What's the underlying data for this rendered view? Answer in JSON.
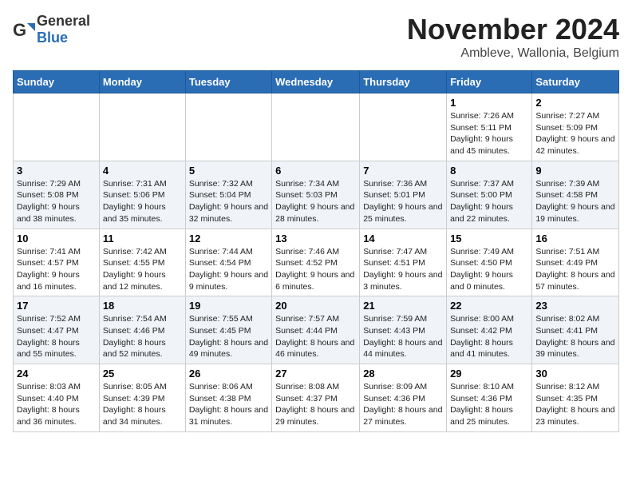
{
  "header": {
    "logo_general": "General",
    "logo_blue": "Blue",
    "month_title": "November 2024",
    "location": "Ambleve, Wallonia, Belgium"
  },
  "weekdays": [
    "Sunday",
    "Monday",
    "Tuesday",
    "Wednesday",
    "Thursday",
    "Friday",
    "Saturday"
  ],
  "weeks": [
    [
      {
        "day": "",
        "info": ""
      },
      {
        "day": "",
        "info": ""
      },
      {
        "day": "",
        "info": ""
      },
      {
        "day": "",
        "info": ""
      },
      {
        "day": "",
        "info": ""
      },
      {
        "day": "1",
        "info": "Sunrise: 7:26 AM\nSunset: 5:11 PM\nDaylight: 9 hours and 45 minutes."
      },
      {
        "day": "2",
        "info": "Sunrise: 7:27 AM\nSunset: 5:09 PM\nDaylight: 9 hours and 42 minutes."
      }
    ],
    [
      {
        "day": "3",
        "info": "Sunrise: 7:29 AM\nSunset: 5:08 PM\nDaylight: 9 hours and 38 minutes."
      },
      {
        "day": "4",
        "info": "Sunrise: 7:31 AM\nSunset: 5:06 PM\nDaylight: 9 hours and 35 minutes."
      },
      {
        "day": "5",
        "info": "Sunrise: 7:32 AM\nSunset: 5:04 PM\nDaylight: 9 hours and 32 minutes."
      },
      {
        "day": "6",
        "info": "Sunrise: 7:34 AM\nSunset: 5:03 PM\nDaylight: 9 hours and 28 minutes."
      },
      {
        "day": "7",
        "info": "Sunrise: 7:36 AM\nSunset: 5:01 PM\nDaylight: 9 hours and 25 minutes."
      },
      {
        "day": "8",
        "info": "Sunrise: 7:37 AM\nSunset: 5:00 PM\nDaylight: 9 hours and 22 minutes."
      },
      {
        "day": "9",
        "info": "Sunrise: 7:39 AM\nSunset: 4:58 PM\nDaylight: 9 hours and 19 minutes."
      }
    ],
    [
      {
        "day": "10",
        "info": "Sunrise: 7:41 AM\nSunset: 4:57 PM\nDaylight: 9 hours and 16 minutes."
      },
      {
        "day": "11",
        "info": "Sunrise: 7:42 AM\nSunset: 4:55 PM\nDaylight: 9 hours and 12 minutes."
      },
      {
        "day": "12",
        "info": "Sunrise: 7:44 AM\nSunset: 4:54 PM\nDaylight: 9 hours and 9 minutes."
      },
      {
        "day": "13",
        "info": "Sunrise: 7:46 AM\nSunset: 4:52 PM\nDaylight: 9 hours and 6 minutes."
      },
      {
        "day": "14",
        "info": "Sunrise: 7:47 AM\nSunset: 4:51 PM\nDaylight: 9 hours and 3 minutes."
      },
      {
        "day": "15",
        "info": "Sunrise: 7:49 AM\nSunset: 4:50 PM\nDaylight: 9 hours and 0 minutes."
      },
      {
        "day": "16",
        "info": "Sunrise: 7:51 AM\nSunset: 4:49 PM\nDaylight: 8 hours and 57 minutes."
      }
    ],
    [
      {
        "day": "17",
        "info": "Sunrise: 7:52 AM\nSunset: 4:47 PM\nDaylight: 8 hours and 55 minutes."
      },
      {
        "day": "18",
        "info": "Sunrise: 7:54 AM\nSunset: 4:46 PM\nDaylight: 8 hours and 52 minutes."
      },
      {
        "day": "19",
        "info": "Sunrise: 7:55 AM\nSunset: 4:45 PM\nDaylight: 8 hours and 49 minutes."
      },
      {
        "day": "20",
        "info": "Sunrise: 7:57 AM\nSunset: 4:44 PM\nDaylight: 8 hours and 46 minutes."
      },
      {
        "day": "21",
        "info": "Sunrise: 7:59 AM\nSunset: 4:43 PM\nDaylight: 8 hours and 44 minutes."
      },
      {
        "day": "22",
        "info": "Sunrise: 8:00 AM\nSunset: 4:42 PM\nDaylight: 8 hours and 41 minutes."
      },
      {
        "day": "23",
        "info": "Sunrise: 8:02 AM\nSunset: 4:41 PM\nDaylight: 8 hours and 39 minutes."
      }
    ],
    [
      {
        "day": "24",
        "info": "Sunrise: 8:03 AM\nSunset: 4:40 PM\nDaylight: 8 hours and 36 minutes."
      },
      {
        "day": "25",
        "info": "Sunrise: 8:05 AM\nSunset: 4:39 PM\nDaylight: 8 hours and 34 minutes."
      },
      {
        "day": "26",
        "info": "Sunrise: 8:06 AM\nSunset: 4:38 PM\nDaylight: 8 hours and 31 minutes."
      },
      {
        "day": "27",
        "info": "Sunrise: 8:08 AM\nSunset: 4:37 PM\nDaylight: 8 hours and 29 minutes."
      },
      {
        "day": "28",
        "info": "Sunrise: 8:09 AM\nSunset: 4:36 PM\nDaylight: 8 hours and 27 minutes."
      },
      {
        "day": "29",
        "info": "Sunrise: 8:10 AM\nSunset: 4:36 PM\nDaylight: 8 hours and 25 minutes."
      },
      {
        "day": "30",
        "info": "Sunrise: 8:12 AM\nSunset: 4:35 PM\nDaylight: 8 hours and 23 minutes."
      }
    ]
  ]
}
